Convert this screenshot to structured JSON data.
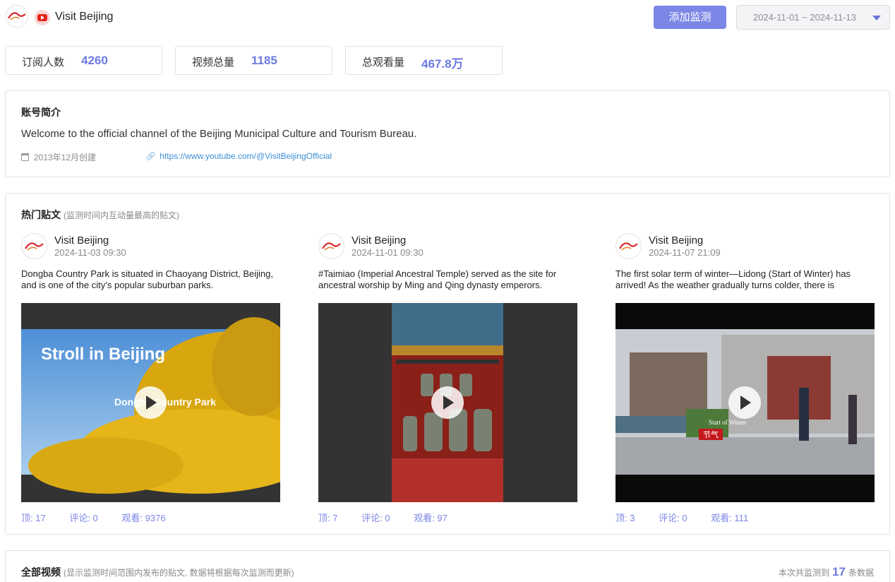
{
  "header": {
    "channel_name": "Visit Beijing",
    "add_button": "添加监测",
    "date_range": "2024-11-01 ~ 2024-11-13"
  },
  "stats": [
    {
      "label": "订阅人数",
      "value": "4260"
    },
    {
      "label": "视频总量",
      "value": "1185"
    },
    {
      "label": "总观看量",
      "value": "467.8万"
    }
  ],
  "profile": {
    "title": "账号简介",
    "description": "Welcome to the official channel of the Beijing Municipal Culture and Tourism Bureau.",
    "created": "2013年12月创建",
    "url": "https://www.youtube.com/@VisitBeijingOfficial"
  },
  "hot_posts": {
    "title": "热门贴文",
    "subtitle": "(监测时间内互动量最高的贴文)",
    "posts": [
      {
        "author": "Visit Beijing",
        "time": "2024-11-03 09:30",
        "text": "Dongba Country Park is situated in Chaoyang District, Beijing, and is one of the city’s popular suburban parks.",
        "thumb_title": "Stroll in Beijing",
        "thumb_caption": "Dongba Country Park",
        "likes": "顶: 17",
        "comments": "评论: 0",
        "views": "观看: 9376"
      },
      {
        "author": "Visit Beijing",
        "time": "2024-11-01 09:30",
        "text": "#Taimiao (Imperial Ancestral Temple) served as the site for ancestral worship by Ming and Qing dynasty emperors.",
        "likes": "顶: 7",
        "comments": "评论: 0",
        "views": "观看: 97"
      },
      {
        "author": "Visit Beijing",
        "time": "2024-11-07 21:09",
        "text": "The first solar term of winter—Lidong (Start of Winter) has arrived! As the weather gradually turns colder, there is",
        "thumb_caption": "Start of Winter",
        "thumb_tag": "节气",
        "likes": "顶: 3",
        "comments": "评论: 0",
        "views": "观看: 111"
      }
    ]
  },
  "all_videos": {
    "title": "全部视频",
    "subtitle": "(显示监测时间范围内发布的贴文, 数据将根据每次监测而更新)",
    "total_prefix": "本次共监测到",
    "total_count": "17",
    "total_suffix": "条数据"
  }
}
